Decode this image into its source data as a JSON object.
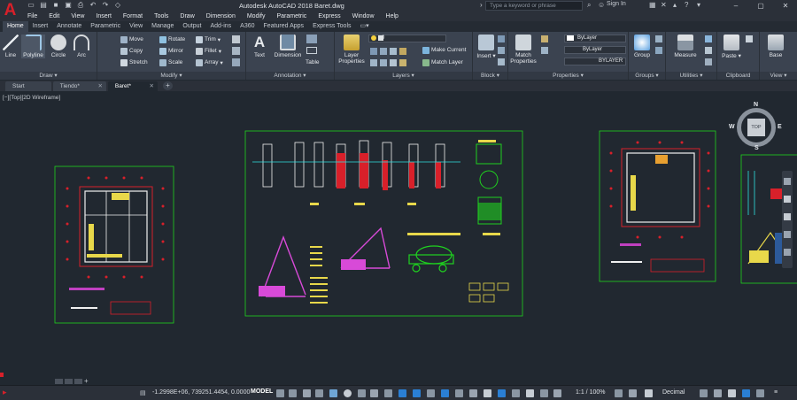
{
  "app": {
    "title": "Autodesk AutoCAD 2018    Baret.dwg",
    "logo_letter": "A",
    "search_placeholder": "Type a keyword or phrase",
    "signin": "Sign In"
  },
  "menu": [
    "File",
    "Edit",
    "View",
    "Insert",
    "Format",
    "Tools",
    "Draw",
    "Dimension",
    "Modify",
    "Parametric",
    "Express",
    "Window",
    "Help"
  ],
  "ribbon_tabs": [
    "Home",
    "Insert",
    "Annotate",
    "Parametric",
    "View",
    "Manage",
    "Output",
    "Add-ins",
    "A360",
    "Featured Apps",
    "Express Tools"
  ],
  "draw": {
    "label": "Draw",
    "line": "Line",
    "polyline": "Polyline",
    "circle": "Circle",
    "arc": "Arc"
  },
  "modify": {
    "label": "Modify",
    "move": "Move",
    "rotate": "Rotate",
    "trim": "Trim",
    "copy": "Copy",
    "mirror": "Mirror",
    "fillet": "Fillet",
    "stretch": "Stretch",
    "scale": "Scale",
    "array": "Array"
  },
  "annotation": {
    "label": "Annotation",
    "text": "Text",
    "dimension": "Dimension",
    "table": "Table"
  },
  "layers": {
    "label": "Layers",
    "layer_properties": "Layer Properties",
    "current_layer": "0",
    "make_current": "Make Current",
    "match_layer": "Match Layer"
  },
  "block": {
    "label": "Block",
    "insert": "Insert"
  },
  "properties": {
    "label": "Properties",
    "match": "Match Properties",
    "color": "ByLayer",
    "linetype": "ByLayer",
    "lineweight": "BYLAYER"
  },
  "groups": {
    "label": "Groups",
    "group": "Group"
  },
  "utilities": {
    "label": "Utilities",
    "measure": "Measure"
  },
  "clipboard": {
    "label": "Clipboard",
    "paste": "Paste"
  },
  "view_panel": {
    "label": "View",
    "base": "Base"
  },
  "doc_tabs": [
    "Start",
    "Tiendo*",
    "Baret*"
  ],
  "viewport_label": "[−][Top][2D Wireframe]",
  "viewcube": {
    "top": "TOP",
    "n": "N",
    "s": "S",
    "e": "E",
    "w": "W"
  },
  "status": {
    "coords": "-1.2998E+06, 739251.4454, 0.0000",
    "model": "MODEL",
    "scale": "1:1 / 100%",
    "units": "Decimal"
  },
  "colors": {
    "accent": "#d8202a",
    "sheet_border": "#1fd11f"
  }
}
